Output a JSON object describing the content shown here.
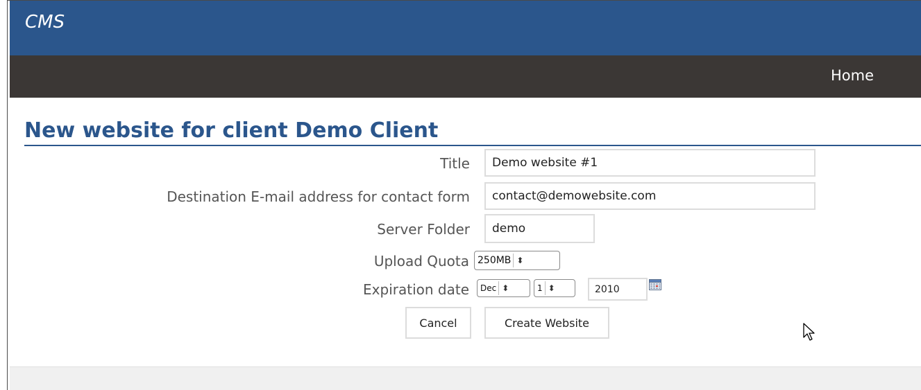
{
  "app": {
    "brand": "CMS"
  },
  "nav": {
    "home": "Home"
  },
  "page": {
    "heading": "New website for client Demo Client"
  },
  "form": {
    "title": {
      "label": "Title",
      "value": "Demo website #1"
    },
    "contact_email": {
      "label": "Destination E-mail address for contact form",
      "value": "contact@demowebsite.com"
    },
    "server_folder": {
      "label": "Server Folder",
      "value": "demo"
    },
    "upload_quota": {
      "label": "Upload Quota",
      "selected": "250MB"
    },
    "expiration": {
      "label": "Expiration date",
      "month": "Dec",
      "day": "1",
      "year": "2010"
    },
    "buttons": {
      "cancel": "Cancel",
      "create": "Create Website"
    }
  },
  "icons": {
    "calendar": "calendar-icon",
    "spinner": "updown-arrows-icon",
    "cursor": "mouse-pointer-icon"
  },
  "colors": {
    "header_blue": "#2b568c",
    "nav_dark": "#3b3735",
    "heading_blue": "#2b568c",
    "label_gray": "#555555"
  }
}
